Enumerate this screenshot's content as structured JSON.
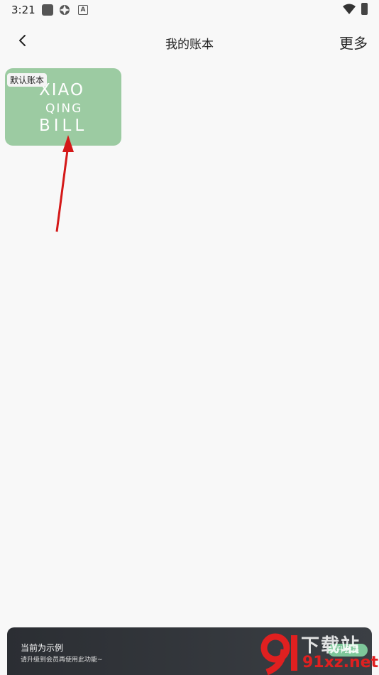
{
  "status_bar": {
    "time": "3:21",
    "icons": [
      "square-icon",
      "gear-icon",
      "a-icon",
      "wifi-icon",
      "battery-icon"
    ]
  },
  "header": {
    "back_icon": "chevron-left-icon",
    "title": "我的账本",
    "more_label": "更多"
  },
  "ledger": {
    "badge": "默认账本",
    "logo_lines": [
      "XIAO",
      "QING",
      "BILL"
    ],
    "card_color": "#9ccba2"
  },
  "banner": {
    "title": "当前为示例",
    "subtitle": "请升级到会员再使用此功能~",
    "button_label": "升会员",
    "accent": "#7ec79a"
  },
  "watermark": {
    "brand": "下载站",
    "domain": "91xz.net",
    "color": "#e02020"
  }
}
